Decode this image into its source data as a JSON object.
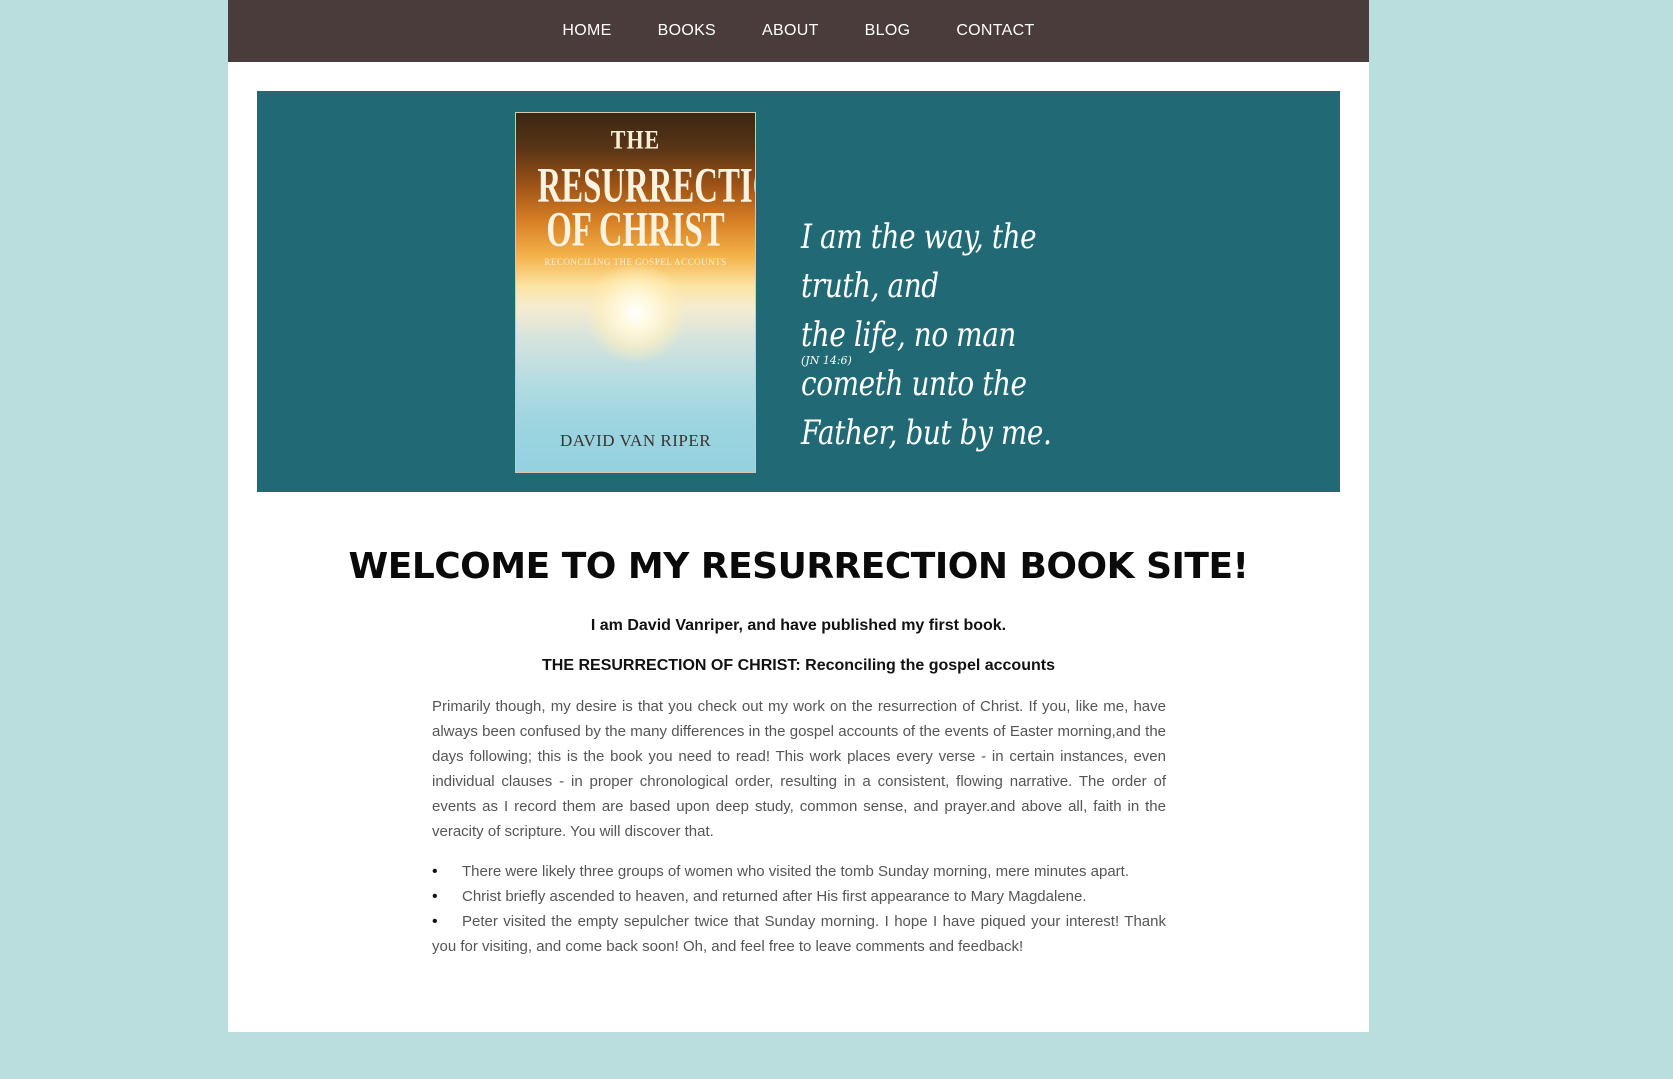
{
  "nav": {
    "items": [
      {
        "label": "HOME"
      },
      {
        "label": "BOOKS"
      },
      {
        "label": "ABOUT"
      },
      {
        "label": "BLOG"
      },
      {
        "label": "CONTACT"
      }
    ]
  },
  "hero": {
    "book": {
      "title_top": "THE",
      "title_line1": "RESURRECTION",
      "title_line2": "OF CHRIST",
      "subtitle": "RECONCILING THE GOSPEL ACCOUNTS",
      "author": "DAVID VAN RIPER"
    },
    "quote_lines": [
      "I am the way, the truth, and",
      "the life, no man cometh unto the",
      "Father, but by me."
    ],
    "citation": "(JN 14:6)"
  },
  "main": {
    "title": "WELCOME TO MY RESURRECTION BOOK SITE!",
    "intro_line_1": "I am David Vanriper, and have published my first book.",
    "intro_line_2": "THE RESURRECTION OF CHRIST: Reconciling the gospel accounts",
    "paragraph": "Primarily though, my desire is that you check out my work on the resurrection of Christ. If you, like me, have always been confused by the many differences in the gospel accounts of the events of Easter morning,and the days following; this is the book you need to read! This work places every verse - in certain instances, even individual clauses - in proper chronological order, resulting in a consistent, flowing narrative. The order of events as I record them are based upon deep study, common sense, and prayer.and above all, faith in the veracity of scripture. You will discover that.",
    "bullets": [
      "There were likely three groups of women who visited the tomb Sunday morning, mere minutes apart.",
      "Christ briefly ascended to heaven, and returned after His first appearance to Mary Magdalene.",
      "Peter visited the empty sepulcher twice that Sunday morning. I hope I have piqued your interest! Thank you for visiting, and come back soon! Oh, and feel free to leave comments and feedback!"
    ]
  },
  "colors": {
    "background": "#b9dedd",
    "nav_bar": "#4a3c3a",
    "hero_banner": "#216a75",
    "page": "#ffffff"
  }
}
